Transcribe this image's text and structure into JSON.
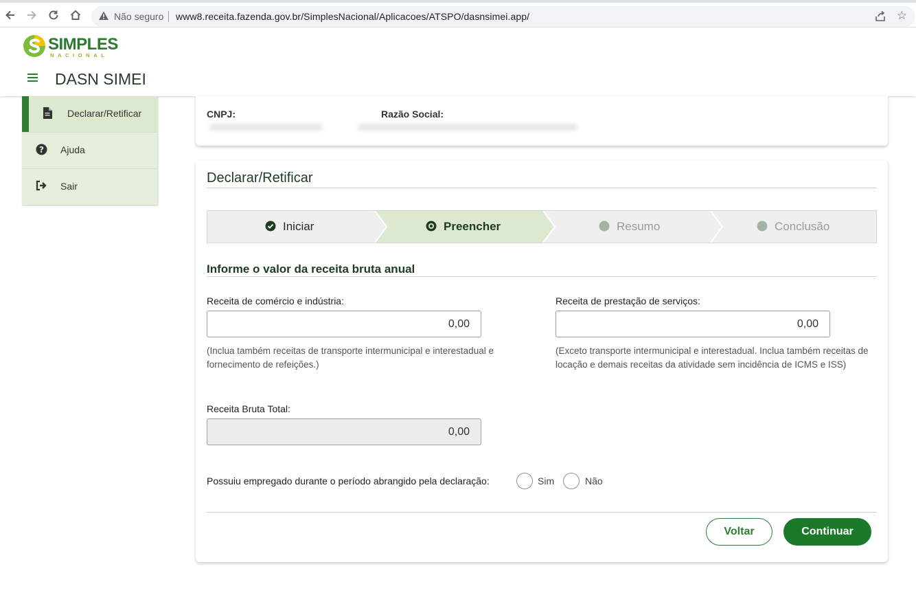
{
  "browser": {
    "security_label": "Não seguro",
    "url": "www8.receita.fazenda.gov.br/SimplesNacional/Aplicacoes/ATSPO/dasnsimei.app/"
  },
  "header": {
    "logo_text": "SIMPLES",
    "logo_subtext": "NACIONAL",
    "title": "DASN SIMEI"
  },
  "sidebar": {
    "items": [
      {
        "label": "Declarar/Retificar",
        "icon": "document-icon",
        "active": true
      },
      {
        "label": "Ajuda",
        "icon": "question-circle-icon",
        "active": false
      },
      {
        "label": "Sair",
        "icon": "sign-out-icon",
        "active": false
      }
    ]
  },
  "company": {
    "cnpj_label": "CNPJ:",
    "razao_label": "Razão Social:"
  },
  "form": {
    "title": "Declarar/Retificar",
    "steps": [
      {
        "label": "Iniciar",
        "state": "done"
      },
      {
        "label": "Preencher",
        "state": "current"
      },
      {
        "label": "Resumo",
        "state": "pending"
      },
      {
        "label": "Conclusão",
        "state": "pending"
      }
    ],
    "section_title": "Informe o valor da receita bruta anual",
    "comercio": {
      "label": "Receita de comércio e indústria:",
      "value": "0,00",
      "hint": "(Inclua também receitas de transporte intermunicipal e interestadual e fornecimento de refeições.)"
    },
    "servicos": {
      "label": "Receita de prestação de serviços:",
      "value": "0,00",
      "hint": "(Exceto transporte intermunicipal e interestadual. Inclua também receitas de locação e demais receitas da atividade sem incidência de ICMS e ISS)"
    },
    "total": {
      "label": "Receita Bruta Total:",
      "value": "0,00"
    },
    "employee_question": "Possuiu empregado durante o período abrangido pela declaração:",
    "option_yes": "Sim",
    "option_no": "Não",
    "back_label": "Voltar",
    "continue_label": "Continuar"
  },
  "colors": {
    "primary_green": "#1b7a2a",
    "step_active_bg": "#dce9cf",
    "sidebar_bg": "#e6efdc"
  }
}
